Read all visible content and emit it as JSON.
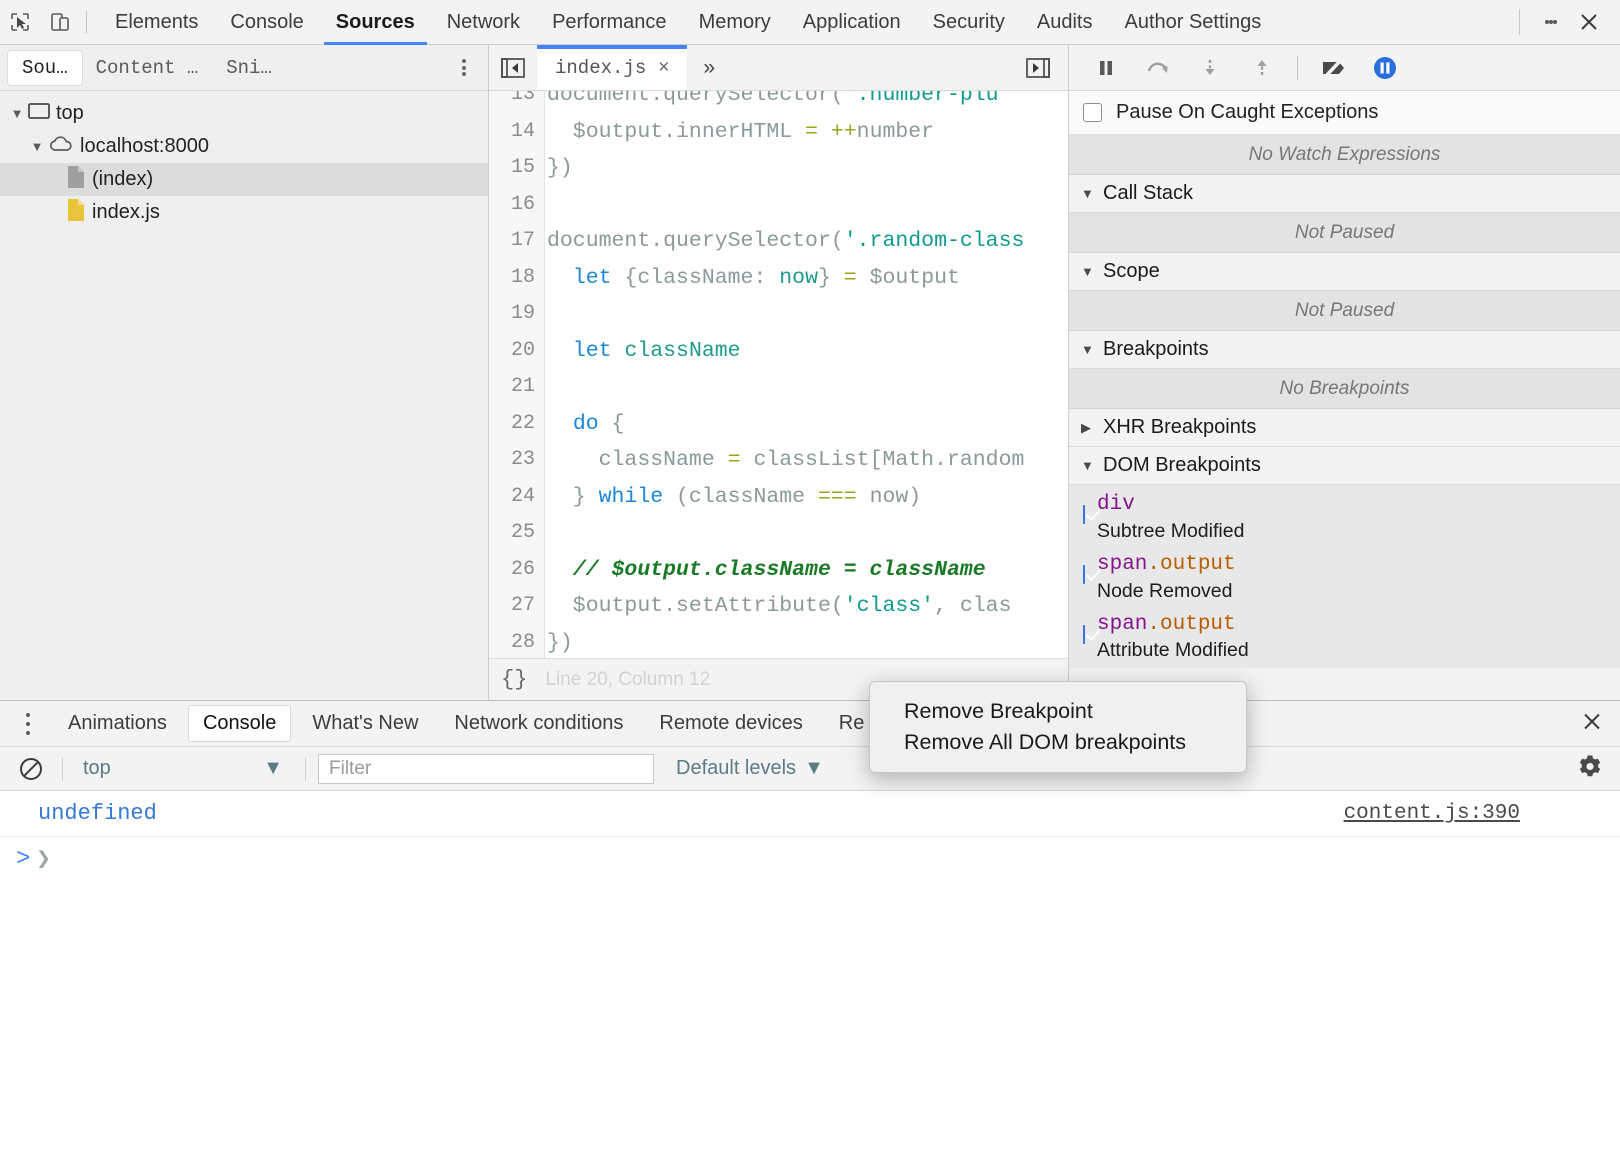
{
  "toolbar": {
    "inspect_icon": "cursor-inspect-icon",
    "device_icon": "device-toolbar-icon",
    "tabs": [
      {
        "label": "Elements",
        "active": false
      },
      {
        "label": "Console",
        "active": false
      },
      {
        "label": "Sources",
        "active": true
      },
      {
        "label": "Network",
        "active": false
      },
      {
        "label": "Performance",
        "active": false
      },
      {
        "label": "Memory",
        "active": false
      },
      {
        "label": "Application",
        "active": false
      },
      {
        "label": "Security",
        "active": false
      },
      {
        "label": "Audits",
        "active": false
      },
      {
        "label": "Author Settings",
        "active": false
      }
    ],
    "more_icon": "more-vertical-icon",
    "close_icon": "close-icon"
  },
  "navigator": {
    "tabs": [
      {
        "label": "Sou…",
        "active": true
      },
      {
        "label": "Content …",
        "active": false
      },
      {
        "label": "Sni…",
        "active": false
      }
    ],
    "more_icon": "more-vertical-icon",
    "tree": [
      {
        "label": "top",
        "icon": "frame-icon",
        "twisty": "▼",
        "depth": 0,
        "selected": false
      },
      {
        "label": "localhost:8000",
        "icon": "cloud-icon",
        "twisty": "▼",
        "depth": 1,
        "selected": false
      },
      {
        "label": "(index)",
        "icon": "document-icon",
        "twisty": "",
        "depth": 2,
        "selected": true
      },
      {
        "label": "index.js",
        "icon": "js-file-icon",
        "twisty": "",
        "depth": 2,
        "selected": false
      }
    ]
  },
  "editor": {
    "collapse_icon": "collapse-sidebar-icon",
    "expand_icon": "expand-sidebar-icon",
    "tab_name": "index.js",
    "tab_close": "×",
    "more_tabs": "»",
    "format_icon": "{}",
    "position": "Line 20, Column 12",
    "lines": [
      {
        "n": "13",
        "cut": true,
        "tokens": [
          {
            "t": "document.querySelector(",
            "c": "plain"
          },
          {
            "t": "'.number-plu",
            "c": "str"
          }
        ]
      },
      {
        "n": "14",
        "tokens": [
          {
            "t": "  $output.innerHTML ",
            "c": "plain"
          },
          {
            "t": "=",
            "c": "op"
          },
          {
            "t": " ",
            "c": "plain"
          },
          {
            "t": "++",
            "c": "op"
          },
          {
            "t": "number",
            "c": "plain"
          }
        ]
      },
      {
        "n": "15",
        "tokens": [
          {
            "t": "})",
            "c": "plain"
          }
        ]
      },
      {
        "n": "16",
        "tokens": []
      },
      {
        "n": "17",
        "tokens": [
          {
            "t": "document.querySelector(",
            "c": "plain"
          },
          {
            "t": "'.random-class",
            "c": "str"
          }
        ]
      },
      {
        "n": "18",
        "tokens": [
          {
            "t": "  ",
            "c": "plain"
          },
          {
            "t": "let",
            "c": "key"
          },
          {
            "t": " {className: ",
            "c": "plain"
          },
          {
            "t": "now",
            "c": "def"
          },
          {
            "t": "} ",
            "c": "plain"
          },
          {
            "t": "=",
            "c": "op"
          },
          {
            "t": " $output",
            "c": "plain"
          }
        ]
      },
      {
        "n": "19",
        "tokens": []
      },
      {
        "n": "20",
        "tokens": [
          {
            "t": "  ",
            "c": "plain"
          },
          {
            "t": "let",
            "c": "key"
          },
          {
            "t": " ",
            "c": "plain"
          },
          {
            "t": "className",
            "c": "def"
          }
        ]
      },
      {
        "n": "21",
        "tokens": []
      },
      {
        "n": "22",
        "tokens": [
          {
            "t": "  ",
            "c": "plain"
          },
          {
            "t": "do",
            "c": "key"
          },
          {
            "t": " {",
            "c": "plain"
          }
        ]
      },
      {
        "n": "23",
        "tokens": [
          {
            "t": "    className ",
            "c": "plain"
          },
          {
            "t": "=",
            "c": "op"
          },
          {
            "t": " classList[Math.random",
            "c": "plain"
          }
        ]
      },
      {
        "n": "24",
        "tokens": [
          {
            "t": "  } ",
            "c": "plain"
          },
          {
            "t": "while",
            "c": "key"
          },
          {
            "t": " (className ",
            "c": "plain"
          },
          {
            "t": "===",
            "c": "op"
          },
          {
            "t": " now)",
            "c": "plain"
          }
        ]
      },
      {
        "n": "25",
        "tokens": []
      },
      {
        "n": "26",
        "tokens": [
          {
            "t": "  ",
            "c": "plain"
          },
          {
            "t": "// $output.className = className",
            "c": "com"
          }
        ]
      },
      {
        "n": "27",
        "tokens": [
          {
            "t": "  $output.setAttribute(",
            "c": "plain"
          },
          {
            "t": "'class'",
            "c": "str"
          },
          {
            "t": ", clas",
            "c": "plain"
          }
        ]
      },
      {
        "n": "28",
        "tokens": [
          {
            "t": "})",
            "c": "plain"
          }
        ]
      }
    ]
  },
  "debugger": {
    "buttons": [
      {
        "name": "pause-resume-button",
        "icon": "pause-icon"
      },
      {
        "name": "step-over-button",
        "icon": "step-over-icon"
      },
      {
        "name": "step-into-button",
        "icon": "step-into-icon"
      },
      {
        "name": "step-out-button",
        "icon": "step-out-icon"
      },
      {
        "name": "deactivate-breakpoints-button",
        "icon": "breakpoint-slash-icon"
      },
      {
        "name": "pause-on-exceptions-button",
        "icon": "pause-circle-icon"
      }
    ],
    "pause_caught_label": "Pause On Caught Exceptions",
    "pause_caught_checked": false,
    "watch_empty": "No Watch Expressions",
    "sections": [
      {
        "label": "Call Stack",
        "expanded": true,
        "empty": "Not Paused"
      },
      {
        "label": "Scope",
        "expanded": true,
        "empty": "Not Paused"
      },
      {
        "label": "Breakpoints",
        "expanded": true,
        "empty": "No Breakpoints"
      },
      {
        "label": "XHR Breakpoints",
        "expanded": false,
        "empty": null
      },
      {
        "label": "DOM Breakpoints",
        "expanded": true,
        "empty": null
      }
    ],
    "dom_breakpoints": [
      {
        "tag": "div",
        "cls": "",
        "type": "Subtree Modified",
        "checked": true
      },
      {
        "tag": "span",
        "cls": ".output",
        "type": "Node Removed",
        "checked": true
      },
      {
        "tag": "span",
        "cls": ".output",
        "type": "Attribute Modified",
        "checked": true
      }
    ],
    "accent_blue": "#4285f4",
    "tag_color": "#881391",
    "class_color": "#b85c00"
  },
  "context_menu": {
    "items": [
      {
        "label": "Remove Breakpoint"
      },
      {
        "label": "Remove All DOM breakpoints"
      }
    ]
  },
  "drawer": {
    "more_icon": "more-vertical-icon",
    "tabs": [
      {
        "label": "Animations",
        "active": false
      },
      {
        "label": "Console",
        "active": true
      },
      {
        "label": "What's New",
        "active": false
      },
      {
        "label": "Network conditions",
        "active": false
      },
      {
        "label": "Remote devices",
        "active": false
      },
      {
        "label": "Re",
        "active": false
      }
    ],
    "close_icon": "close-icon"
  },
  "console": {
    "clear_icon": "clear-console-icon",
    "context_value": "top",
    "context_caret": "▼",
    "filter_placeholder": "Filter",
    "filter_value": "",
    "levels_label": "Default levels",
    "levels_caret": "▼",
    "settings_icon": "gear-icon",
    "messages": [
      {
        "text": "undefined",
        "source": "content.js:390"
      }
    ],
    "prompt_arrow": ">",
    "prompt_caret": "❯"
  }
}
